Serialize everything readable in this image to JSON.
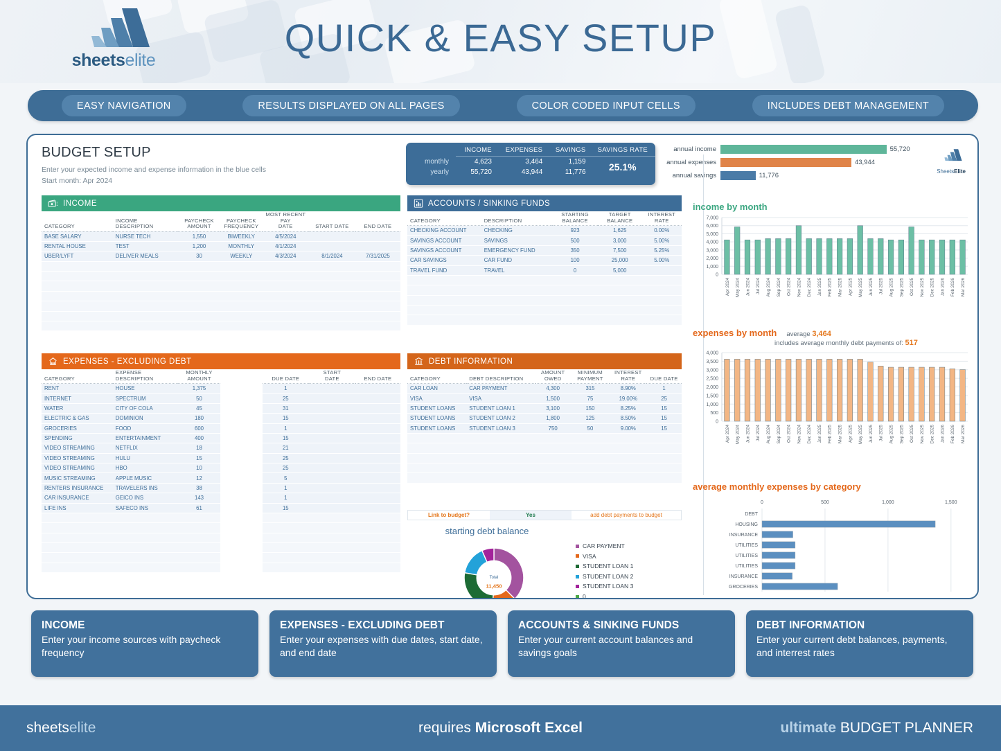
{
  "header": {
    "title": "QUICK & EASY SETUP",
    "logo_primary": "sheets",
    "logo_secondary": "elite",
    "logo_icon": "mountain-logo-icon"
  },
  "nav": {
    "items": [
      "EASY NAVIGATION",
      "RESULTS DISPLAYED ON ALL PAGES",
      "COLOR CODED INPUT CELLS",
      "INCLUDES DEBT MANAGEMENT"
    ]
  },
  "sheet": {
    "title": "BUDGET SETUP",
    "subtitle": "Enter your expected income and expense information in the blue cells",
    "start_month": "Start month:  Apr 2024"
  },
  "summary": {
    "columns": [
      "",
      "INCOME",
      "EXPENSES",
      "SAVINGS",
      "SAVINGS RATE"
    ],
    "rows": [
      {
        "label": "monthly",
        "income": "4,623",
        "expenses": "3,464",
        "savings": "1,159"
      },
      {
        "label": "yearly",
        "income": "55,720",
        "expenses": "43,944",
        "savings": "11,776"
      }
    ],
    "savings_rate": "25.1%"
  },
  "brand_small": {
    "a": "Sheets",
    "b": "Elite"
  },
  "income": {
    "header": "INCOME",
    "icon": "cash-icon",
    "color": "#3aa680",
    "columns": [
      "CATEGORY",
      "INCOME DESCRIPTION",
      "PAYCHECK AMOUNT",
      "PAYCHECK FREQUENCY",
      "MOST RECENT PAY DATE",
      "START DATE",
      "END DATE"
    ],
    "rows": [
      [
        "BASE SALARY",
        "NURSE TECH",
        "1,550",
        "BIWEEKLY",
        "4/5/2024",
        "",
        ""
      ],
      [
        "RENTAL HOUSE",
        "TEST",
        "1,200",
        "MONTHLY",
        "4/1/2024",
        "",
        ""
      ],
      [
        "UBER/LYFT",
        "DELIVER MEALS",
        "30",
        "WEEKLY",
        "4/3/2024",
        "8/1/2024",
        "7/31/2025"
      ]
    ],
    "blank_rows": 7
  },
  "accounts": {
    "header": "ACCOUNTS / SINKING FUNDS",
    "icon": "bar-chart-icon",
    "color": "#3d6d98",
    "columns": [
      "CATEGORY",
      "DESCRIPTION",
      "STARTING BALANCE",
      "TARGET BALANCE",
      "INTEREST RATE"
    ],
    "rows": [
      [
        "CHECKING ACCOUNT",
        "CHECKING",
        "923",
        "1,625",
        "0.00%"
      ],
      [
        "SAVINGS ACCOUNT",
        "SAVINGS",
        "500",
        "3,000",
        "5.00%"
      ],
      [
        "SAVINGS ACCOUNT",
        "EMERGENCY FUND",
        "350",
        "7,500",
        "5.25%"
      ],
      [
        "CAR SAVINGS",
        "CAR FUND",
        "100",
        "25,000",
        "5.00%"
      ],
      [
        "TRAVEL FUND",
        "TRAVEL",
        "0",
        "5,000",
        ""
      ]
    ],
    "blank_rows": 5
  },
  "expenses": {
    "header": "EXPENSES - EXCLUDING DEBT",
    "icon": "house-icon",
    "color": "#e4681b",
    "columns": [
      "CATEGORY",
      "EXPENSE DESCRIPTION",
      "MONTHLY AMOUNT",
      "",
      "DUE DATE",
      "START DATE",
      "END DATE"
    ],
    "rows": [
      [
        "RENT",
        "HOUSE",
        "1,375",
        "1",
        "",
        ""
      ],
      [
        "INTERNET",
        "SPECTRUM",
        "50",
        "25",
        "",
        ""
      ],
      [
        "WATER",
        "CITY OF COLA",
        "45",
        "31",
        "",
        ""
      ],
      [
        "ELECTRIC & GAS",
        "DOMINION",
        "180",
        "15",
        "",
        ""
      ],
      [
        "GROCERIES",
        "FOOD",
        "600",
        "1",
        "",
        ""
      ],
      [
        "SPENDING",
        "ENTERTAINMENT",
        "400",
        "15",
        "",
        ""
      ],
      [
        "VIDEO STREAMING",
        "NETFLIX",
        "18",
        "21",
        "",
        ""
      ],
      [
        "VIDEO STREAMING",
        "HULU",
        "15",
        "25",
        "",
        ""
      ],
      [
        "VIDEO STREAMING",
        "HBO",
        "10",
        "25",
        "",
        ""
      ],
      [
        "MUSIC STREAMING",
        "APPLE MUSIC",
        "12",
        "5",
        "",
        ""
      ],
      [
        "RENTERS INSURANCE",
        "TRAVELERS INS",
        "38",
        "1",
        "",
        ""
      ],
      [
        "CAR INSURANCE",
        "GEICO INS",
        "143",
        "1",
        "",
        ""
      ],
      [
        "LIFE INS",
        "SAFECO INS",
        "61",
        "15",
        "",
        ""
      ]
    ],
    "blank_rows": 6
  },
  "debt": {
    "header": "DEBT INFORMATION",
    "icon": "bank-icon",
    "color": "#d4651a",
    "columns": [
      "CATEGORY",
      "DEBT DESCRIPTION",
      "AMOUNT OWED",
      "MINIMUM PAYMENT",
      "INTEREST RATE",
      "DUE DATE"
    ],
    "rows": [
      [
        "CAR LOAN",
        "CAR PAYMENT",
        "4,300",
        "315",
        "8.90%",
        "1"
      ],
      [
        "VISA",
        "VISA",
        "1,500",
        "75",
        "19.00%",
        "25"
      ],
      [
        "STUDENT LOANS",
        "STUDENT LOAN 1",
        "3,100",
        "150",
        "8.25%",
        "15"
      ],
      [
        "STUDENT LOANS",
        "STUDENT LOAN 2",
        "1,800",
        "125",
        "8.50%",
        "15"
      ],
      [
        "STUDENT LOANS",
        "STUDENT LOAN 3",
        "750",
        "50",
        "9.00%",
        "15"
      ]
    ],
    "blank_rows": 5,
    "link_label": "Link to budget?",
    "link_value": "Yes",
    "link_note": "add debt payments to budget"
  },
  "chart_data": [
    {
      "type": "bar",
      "id": "annual-summary",
      "orientation": "horizontal",
      "categories": [
        "annual income",
        "annual expenses",
        "annual savings"
      ],
      "values": [
        55720,
        43944,
        11776
      ],
      "labels": [
        "55,720",
        "43,944",
        "11,776"
      ],
      "colors": [
        "#5fb69a",
        "#e08449",
        "#4a7ba7"
      ],
      "xmax": 60000,
      "title": "",
      "xlabel": "",
      "ylabel": "",
      "grid": false,
      "legend": "none"
    },
    {
      "type": "bar",
      "id": "income-by-month",
      "title": "income by month",
      "title_color": "#3aa680",
      "color": "#6cbfa5",
      "categories": [
        "Apr 2024",
        "May 2024",
        "Jun 2024",
        "Jul 2024",
        "Aug 2024",
        "Sep 2024",
        "Oct 2024",
        "Nov 2024",
        "Dec 2024",
        "Jan 2025",
        "Feb 2025",
        "Mar 2025",
        "Apr 2025",
        "May 2025",
        "Jun 2025",
        "Jul 2025",
        "Aug 2025",
        "Sep 2025",
        "Oct 2025",
        "Nov 2025",
        "Dec 2025",
        "Jan 2026",
        "Feb 2026",
        "Mar 2026"
      ],
      "values": [
        4250,
        5850,
        4250,
        4250,
        4400,
        4400,
        4400,
        6000,
        4400,
        4400,
        4400,
        4400,
        4400,
        6000,
        4400,
        4400,
        4250,
        4250,
        5850,
        4250,
        4250,
        4250,
        4250,
        4250
      ],
      "ylim": [
        0,
        7000
      ],
      "yticks": [
        0,
        1000,
        2000,
        3000,
        4000,
        5000,
        6000,
        7000
      ],
      "ytick_labels": [
        "0",
        "1,000",
        "2,000",
        "3,000",
        "4,000",
        "5,000",
        "6,000",
        "7,000"
      ],
      "xlabel": "",
      "ylabel": "",
      "grid": true,
      "legend": "none"
    },
    {
      "type": "bar",
      "id": "expenses-by-month",
      "title": "expenses by month",
      "title_color": "#e4681b",
      "color": "#f3b684",
      "note_label": "average",
      "note_value": "3,464",
      "note2_label": "includes average monthly debt payments of:",
      "note2_value": "517",
      "categories": [
        "Apr 2024",
        "May 2024",
        "Jun 2024",
        "Jul 2024",
        "Aug 2024",
        "Sep 2024",
        "Oct 2024",
        "Nov 2024",
        "Dec 2024",
        "Jan 2025",
        "Feb 2025",
        "Mar 2025",
        "Apr 2025",
        "May 2025",
        "Jun 2025",
        "Jul 2025",
        "Aug 2025",
        "Sep 2025",
        "Oct 2025",
        "Nov 2025",
        "Dec 2025",
        "Jan 2026",
        "Feb 2026",
        "Mar 2026"
      ],
      "values": [
        3620,
        3620,
        3620,
        3620,
        3620,
        3620,
        3620,
        3620,
        3620,
        3620,
        3620,
        3620,
        3620,
        3620,
        3450,
        3220,
        3150,
        3150,
        3150,
        3150,
        3150,
        3150,
        3060,
        3010
      ],
      "ylim": [
        0,
        4000
      ],
      "yticks": [
        0,
        500,
        1000,
        1500,
        2000,
        2500,
        3000,
        3500,
        4000
      ],
      "ytick_labels": [
        "0",
        "500",
        "1,000",
        "1,500",
        "2,000",
        "2,500",
        "3,000",
        "3,500",
        "4,000"
      ],
      "xlabel": "",
      "ylabel": "",
      "grid": true,
      "legend": "none"
    },
    {
      "type": "bar",
      "id": "avg-expenses-by-category",
      "orientation": "horizontal",
      "title": "average monthly expenses by category",
      "title_color": "#e4681b",
      "color": "#5b8fc0",
      "categories": [
        "DEBT",
        "HOUSING",
        "INSURANCE",
        "UTILITIES",
        "UTILITIES",
        "UTILITIES",
        "INSURANCE",
        "GROCERIES"
      ],
      "values": [
        0,
        1375,
        245,
        263,
        263,
        263,
        240,
        600
      ],
      "xlim": [
        0,
        1600
      ],
      "xticks": [
        0,
        500,
        1000,
        1500
      ],
      "xtick_labels": [
        "0",
        "500",
        "1,000",
        "1,500"
      ],
      "grid": true,
      "legend": "none"
    },
    {
      "type": "pie",
      "id": "starting-debt-balance",
      "title": "starting debt balance",
      "total_label": "Total",
      "total_value": "11,450",
      "labels": [
        "CAR PAYMENT",
        "VISA",
        "STUDENT LOAN 1",
        "STUDENT LOAN 2",
        "STUDENT LOAN 3",
        "0"
      ],
      "values": [
        4300,
        1500,
        3100,
        1800,
        750,
        0
      ],
      "colors": [
        "#a3539f",
        "#e4681b",
        "#1d6b35",
        "#23a2d9",
        "#a3239b",
        "#4ba845"
      ],
      "legend": "right"
    }
  ],
  "cards": [
    {
      "title": "INCOME",
      "desc": "Enter your income sources with paycheck frequency"
    },
    {
      "title": "EXPENSES - EXCLUDING DEBT",
      "desc": "Enter your expenses with due dates, start date, and end date"
    },
    {
      "title": "ACCOUNTS & SINKING FUNDS",
      "desc": "Enter your current account balances and savings goals"
    },
    {
      "title": "DEBT INFORMATION",
      "desc": "Enter your current debt balances, payments, and interrest rates"
    }
  ],
  "footer": {
    "left_a": "sheets",
    "left_b": "elite",
    "center_pre": "requires ",
    "center_bold": "Microsoft Excel",
    "right_bold": "ultimate",
    "right_rest": " BUDGET PLANNER"
  }
}
